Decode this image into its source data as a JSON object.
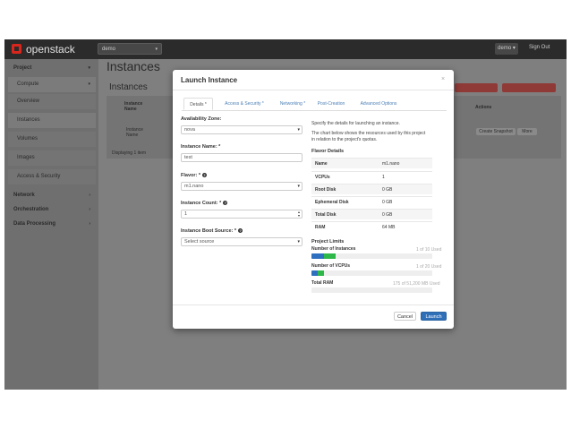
{
  "header": {
    "logo": "openstack",
    "project_selector": "demo",
    "user_menu": "demo",
    "sign_out": "Sign Out"
  },
  "sidebar": {
    "items": [
      {
        "label": "Project",
        "type": "head"
      },
      {
        "label": "Compute",
        "type": "group"
      },
      {
        "label": "Overview",
        "type": "item"
      },
      {
        "label": "Instances",
        "type": "item"
      },
      {
        "label": "Volumes",
        "type": "item"
      },
      {
        "label": "Images",
        "type": "item"
      },
      {
        "label": "Access & Security",
        "type": "item"
      },
      {
        "label": "Network",
        "type": "head"
      },
      {
        "label": "Orchestration",
        "type": "head"
      },
      {
        "label": "Data Processing",
        "type": "head"
      }
    ]
  },
  "page": {
    "title": "Instances",
    "subtitle": "Instances",
    "table_headers": {
      "name": "Instance Name",
      "actions": "Actions"
    },
    "row": {
      "name": "Instance Name",
      "create_snapshot": "Create Snapshot",
      "more": "More"
    },
    "footer": "Displaying 1 item"
  },
  "modal": {
    "title": "Launch Instance",
    "close": "×",
    "tabs": [
      "Details *",
      "Access & Security *",
      "Networking *",
      "Post-Creation",
      "Advanced Options"
    ],
    "fields": {
      "availability_zone": {
        "label": "Availability Zone:",
        "value": "nova"
      },
      "instance_name": {
        "label": "Instance Name: *",
        "value": "test"
      },
      "flavor": {
        "label": "Flavor: *",
        "value": "m1.nano"
      },
      "instance_count": {
        "label": "Instance Count: *",
        "value": "1"
      },
      "boot_source": {
        "label": "Instance Boot Source: *",
        "value": "Select source"
      }
    },
    "description": {
      "line1": "Specify the details for launching an instance.",
      "line2": "The chart below shows the resources used by this project",
      "line3": "in relation to the project's quotas."
    },
    "flavor_details": {
      "title": "Flavor Details",
      "rows": [
        {
          "key": "Name",
          "value": "m1.nano"
        },
        {
          "key": "VCPUs",
          "value": "1"
        },
        {
          "key": "Root Disk",
          "value": "0 GB"
        },
        {
          "key": "Ephemeral Disk",
          "value": "0 GB"
        },
        {
          "key": "Total Disk",
          "value": "0 GB"
        },
        {
          "key": "RAM",
          "value": "64 MB"
        }
      ]
    },
    "project_limits": {
      "title": "Project Limits",
      "limits": [
        {
          "label": "Number of Instances",
          "used_text": "1 of 10 Used",
          "used_fraction": 0.1,
          "added_fraction": 0.1
        },
        {
          "label": "Number of VCPUs",
          "used_text": "1 of 20 Used",
          "used_fraction": 0.05,
          "added_fraction": 0.05
        },
        {
          "label": "Total RAM",
          "used_text": "175 of 51,200 MB Used",
          "used_fraction": 0.0,
          "added_fraction": 0.0
        }
      ]
    },
    "buttons": {
      "cancel": "Cancel",
      "launch": "Launch"
    }
  },
  "colors": {
    "primary": "#3070b8",
    "bar_used": "#2f6fbf",
    "bar_added": "#2fb84a"
  }
}
